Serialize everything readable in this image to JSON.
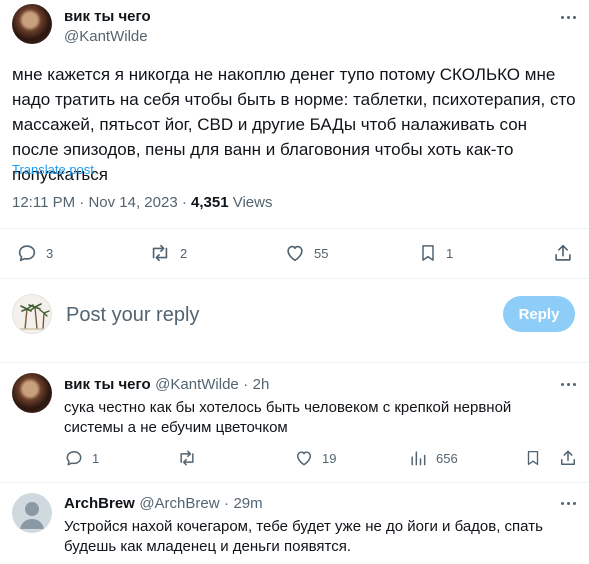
{
  "tweet": {
    "author_name": "вик ты чего",
    "handle": "@KantWilde",
    "text": "мне кажется я никогда не накоплю денег тупо потому СКОЛЬКО мне надо тратить на себя чтобы быть в норме: таблетки, психотерапия, сто массажей, пятьсот йог, CBD и другие БАДы чтоб налаживать сон после эпизодов, пены для ванн и благовония чтобы хоть как-то попускаться",
    "translate_label": "Translate post",
    "time": "12:11 PM",
    "sep": "·",
    "date": "Nov 14, 2023",
    "views_count": "4,351",
    "views_label": "Views",
    "stats": {
      "replies": "3",
      "reposts": "2",
      "likes": "55",
      "bookmarks": "1"
    }
  },
  "composer": {
    "placeholder": "Post your reply",
    "reply_button": "Reply"
  },
  "replies": [
    {
      "author_name": "вик ты чего",
      "handle": "@KantWilde",
      "sep": "·",
      "time": "2h",
      "text": "сука честно как бы хотелось быть человеком с крепкой нервной системы а не ебучим цветочком",
      "stats": {
        "replies": "1",
        "reposts": "",
        "likes": "19",
        "views": "656"
      }
    },
    {
      "author_name": "ArchBrew",
      "handle": "@ArchBrew",
      "sep": "·",
      "time": "29m",
      "text": "Устройся нахой кочегаром, тебе будет уже не до йоги и бадов, спать будешь как младенец и деньги появятся."
    }
  ],
  "colors": {
    "accent": "#1d9bf0",
    "reply_button_disabled": "#8ecdf8",
    "muted_text": "#536471",
    "divider": "#eff3f4"
  },
  "icons": [
    "more-icon",
    "reply-icon",
    "repost-icon",
    "like-icon",
    "bookmark-icon",
    "share-icon",
    "views-icon"
  ]
}
